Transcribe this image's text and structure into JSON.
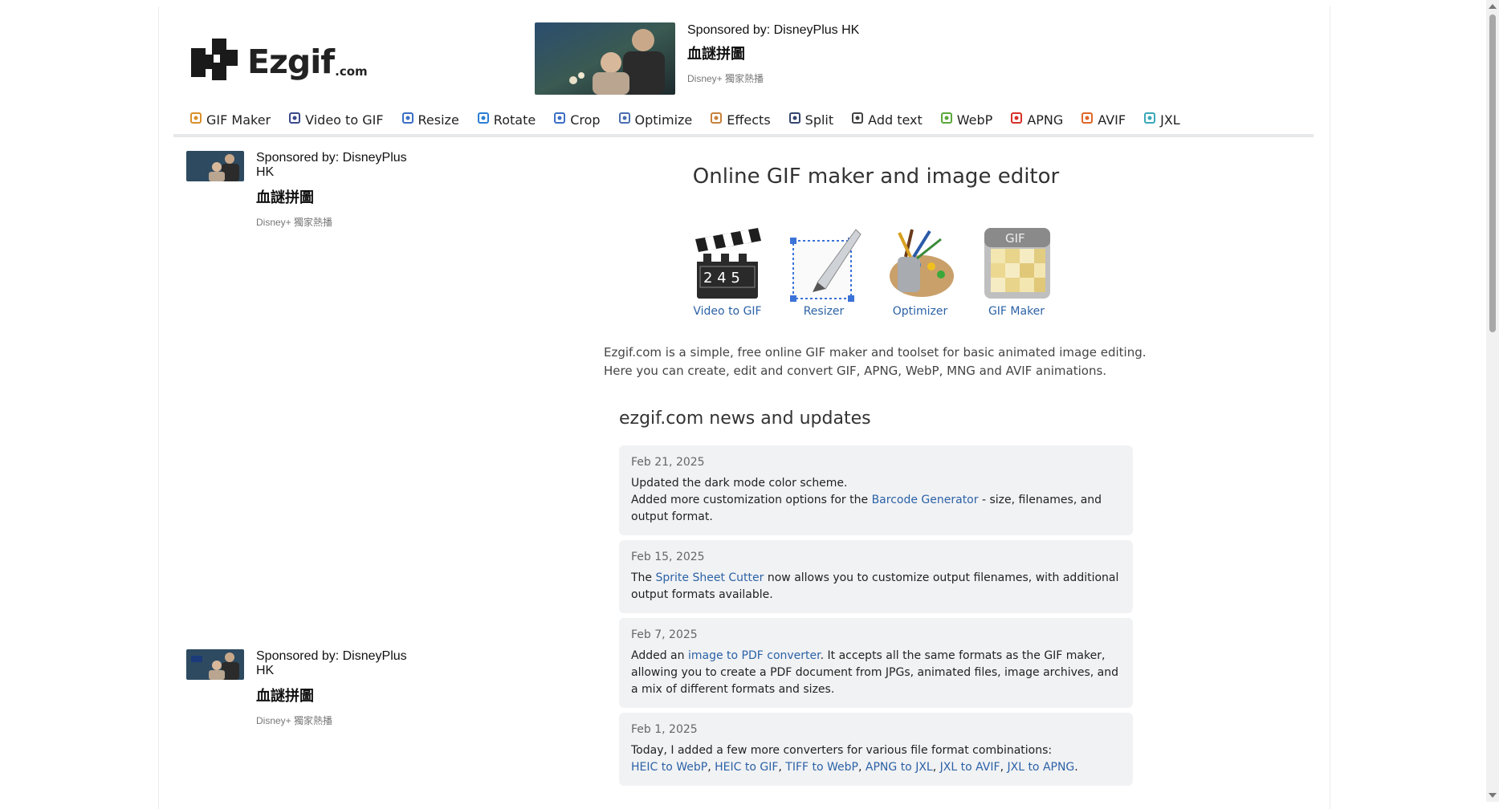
{
  "logo": {
    "word": "Ezgif",
    "suffix": ".com"
  },
  "sponsor": {
    "sponsor_label": "Sponsored by: DisneyPlus HK",
    "title": "血謎拼圖",
    "subtitle": "Disney+ 獨家熱播",
    "side_sponsor_line1": "Sponsored by: DisneyPlus",
    "side_sponsor_line2": "HK"
  },
  "nav": [
    {
      "label": "GIF Maker",
      "icon": "gif-maker-icon",
      "color": "#d9902a"
    },
    {
      "label": "Video to GIF",
      "icon": "film-icon",
      "color": "#3a4a8c"
    },
    {
      "label": "Resize",
      "icon": "resize-icon",
      "color": "#3b6fc4"
    },
    {
      "label": "Rotate",
      "icon": "rotate-icon",
      "color": "#2a7fd4"
    },
    {
      "label": "Crop",
      "icon": "crop-icon",
      "color": "#3b6fc4"
    },
    {
      "label": "Optimize",
      "icon": "optimize-icon",
      "color": "#4a6fb0"
    },
    {
      "label": "Effects",
      "icon": "palette-icon",
      "color": "#c8813a"
    },
    {
      "label": "Split",
      "icon": "split-icon",
      "color": "#34466e"
    },
    {
      "label": "Add text",
      "icon": "add-text-icon",
      "color": "#444"
    },
    {
      "label": "WebP",
      "icon": "webp-icon",
      "color": "#5aa83a"
    },
    {
      "label": "APNG",
      "icon": "apng-icon",
      "color": "#d8322a"
    },
    {
      "label": "AVIF",
      "icon": "avif-icon",
      "color": "#e0672a"
    },
    {
      "label": "JXL",
      "icon": "jxl-icon",
      "color": "#3aa8b8"
    }
  ],
  "main": {
    "title": "Online GIF maker and image editor",
    "tools": [
      {
        "label": "Video to GIF",
        "icon": "clapperboard-icon"
      },
      {
        "label": "Resizer",
        "icon": "resizer-icon"
      },
      {
        "label": "Optimizer",
        "icon": "paint-palette-icon"
      },
      {
        "label": "GIF Maker",
        "icon": "gif-calendar-icon"
      }
    ],
    "intro_line1": "Ezgif.com is a simple, free online GIF maker and toolset for basic animated image editing.",
    "intro_line2": "Here you can create, edit and convert GIF, APNG, WebP, MNG and AVIF animations."
  },
  "news": {
    "title": "ezgif.com news and updates",
    "items": [
      {
        "date": "Feb 21, 2025",
        "line1": "Updated the dark mode color scheme.",
        "pre": "Added more customization options for the ",
        "link": "Barcode Generator",
        "post": " - size, filenames, and output format."
      },
      {
        "date": "Feb 15, 2025",
        "pre": "The ",
        "link": "Sprite Sheet Cutter",
        "post": " now allows you to customize output filenames, with additional output formats available."
      },
      {
        "date": "Feb 7, 2025",
        "pre": "Added an ",
        "link": "image to PDF converter",
        "post": ". It accepts all the same formats as the GIF maker, allowing you to create a PDF document from JPGs, animated files, image archives, and a mix of different formats and sizes."
      },
      {
        "date": "Feb 1, 2025",
        "line1": "Today, I added a few more converters for various file format combinations:",
        "links": [
          "HEIC to WebP",
          "HEIC to GIF",
          "TIFF to WebP",
          "APNG to JXL",
          "JXL to AVIF",
          "JXL to APNG"
        ],
        "end": "."
      }
    ]
  }
}
